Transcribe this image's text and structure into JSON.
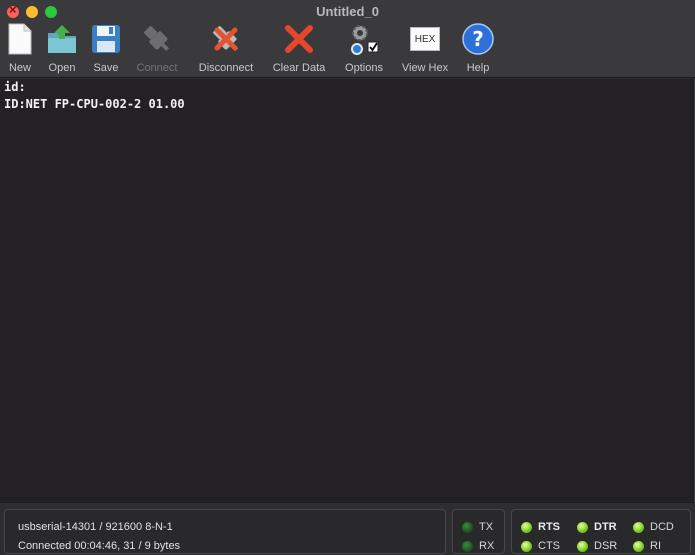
{
  "window": {
    "title": "Untitled_0"
  },
  "toolbar": {
    "items": [
      {
        "label": "New",
        "icon": "new-document-icon",
        "enabled": true
      },
      {
        "label": "Open",
        "icon": "open-folder-icon",
        "enabled": true
      },
      {
        "label": "Save",
        "icon": "floppy-disk-icon",
        "enabled": true
      },
      {
        "label": "Connect",
        "icon": "usb-plug-icon",
        "enabled": false
      },
      {
        "label": "Disconnect",
        "icon": "usb-unplug-icon",
        "enabled": true
      },
      {
        "label": "Clear Data",
        "icon": "red-x-icon",
        "enabled": true
      },
      {
        "label": "Options",
        "icon": "gears-icon",
        "enabled": true
      },
      {
        "label": "View Hex",
        "icon": "hex-icon",
        "enabled": true
      },
      {
        "label": "Help",
        "icon": "help-icon",
        "enabled": true
      }
    ],
    "hex_icon_text": "HEX"
  },
  "terminal": {
    "lines": [
      "id:",
      "ID:NET FP-CPU-002-2 01.00"
    ]
  },
  "status": {
    "port": "usbserial-14301 / 921600 8-N-1",
    "connection": "Connected 00:04:46, 31 / 9 bytes",
    "tx_label": "TX",
    "rx_label": "RX",
    "rts_label": "RTS",
    "cts_label": "CTS",
    "dtr_label": "DTR",
    "dsr_label": "DSR",
    "dcd_label": "DCD",
    "ri_label": "RI"
  }
}
